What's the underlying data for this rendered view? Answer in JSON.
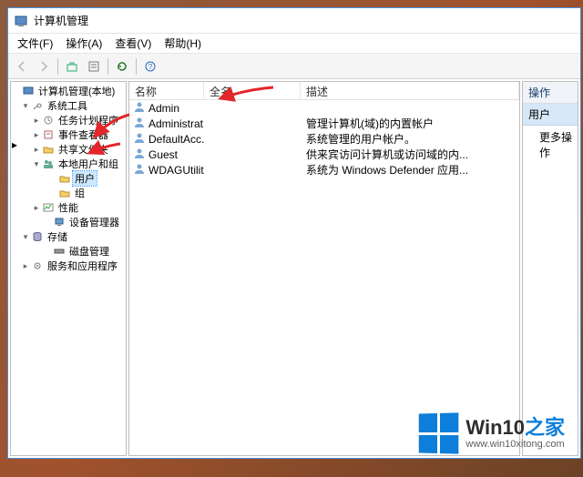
{
  "window": {
    "title": "计算机管理"
  },
  "menu": {
    "file": "文件(F)",
    "action": "操作(A)",
    "view": "查看(V)",
    "help": "帮助(H)"
  },
  "tree": {
    "root": "计算机管理(本地)",
    "system_tools": "系统工具",
    "task_scheduler": "任务计划程序",
    "event_viewer": "事件查看器",
    "shared_folders": "共享文件夹",
    "local_users": "本地用户和组",
    "users": "用户",
    "groups": "组",
    "performance": "性能",
    "device_manager": "设备管理器",
    "storage": "存储",
    "disk_mgmt": "磁盘管理",
    "services_apps": "服务和应用程序"
  },
  "columns": {
    "name": "名称",
    "fullname": "全名",
    "desc": "描述"
  },
  "users_list": [
    {
      "name": "Admin",
      "fullname": "",
      "desc": ""
    },
    {
      "name": "Administrat...",
      "fullname": "",
      "desc": "管理计算机(域)的内置帐户"
    },
    {
      "name": "DefaultAcc...",
      "fullname": "",
      "desc": "系统管理的用户帐户。"
    },
    {
      "name": "Guest",
      "fullname": "",
      "desc": "供来宾访问计算机或访问域的内..."
    },
    {
      "name": "WDAGUtilit...",
      "fullname": "",
      "desc": "系统为 Windows Defender 应用..."
    }
  ],
  "actions": {
    "header": "操作",
    "context": "用户",
    "more": "更多操作"
  },
  "watermark": {
    "brand_a": "Win10",
    "brand_b": "之家",
    "url": "www.win10xitong.com"
  }
}
